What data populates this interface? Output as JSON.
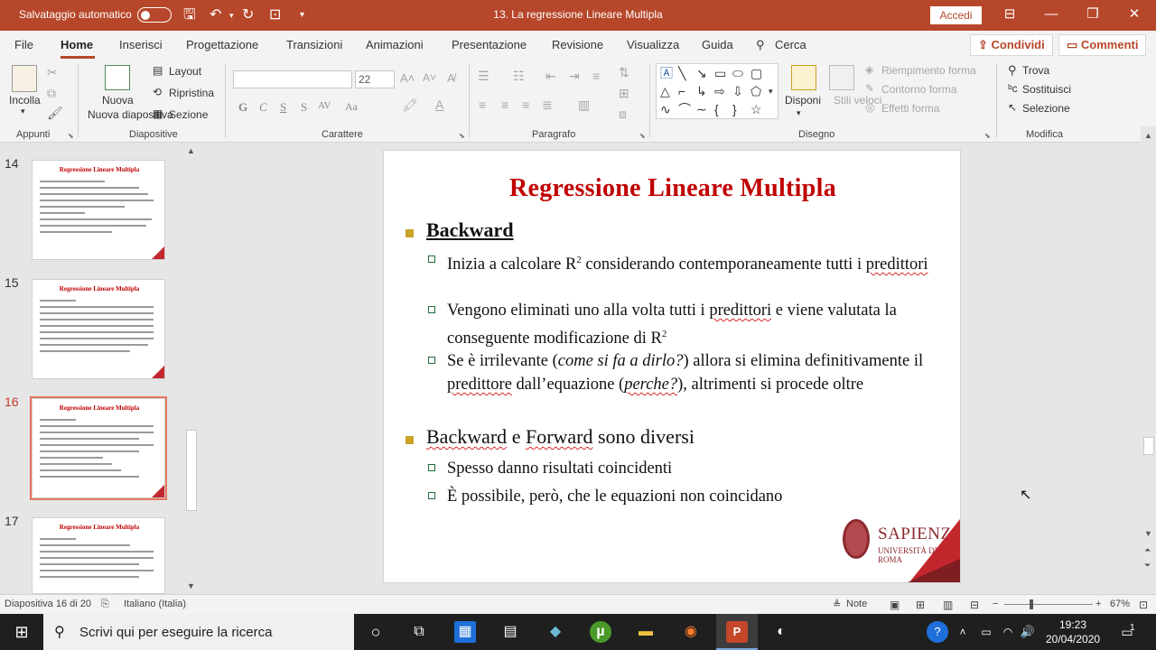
{
  "titlebar": {
    "autosave_label": "Salvataggio automatico",
    "document_title": "13. La regressione Lineare Multipla",
    "signin_label": "Accedi"
  },
  "menu": {
    "tabs": [
      "File",
      "Home",
      "Inserisci",
      "Progettazione",
      "Transizioni",
      "Animazioni",
      "Presentazione",
      "Revisione",
      "Visualizza",
      "Guida",
      "Cerca"
    ],
    "active_tab": "Home",
    "share_label": "Condividi",
    "comments_label": "Commenti"
  },
  "ribbon": {
    "clipboard": {
      "paste_label": "Incolla",
      "group_label": "Appunti"
    },
    "slides": {
      "new_slide_label": "Nuova diapositiva",
      "layout_label": "Layout",
      "reset_label": "Ripristina",
      "section_label": "Sezione",
      "group_label": "Diapositive"
    },
    "font": {
      "font_name_value": "",
      "font_size_value": "22",
      "group_label": "Carattere",
      "format_buttons": [
        "G",
        "C",
        "S",
        "S",
        "AV",
        "Aa"
      ]
    },
    "paragraph": {
      "group_label": "Paragrafo"
    },
    "drawing": {
      "arrange_label": "Disponi",
      "quick_styles_label": "Stili veloci",
      "fill_label": "Riempimento forma",
      "outline_label": "Contorno forma",
      "effects_label": "Effetti forma",
      "group_label": "Disegno"
    },
    "editing": {
      "find_label": "Trova",
      "replace_label": "Sostituisci",
      "select_label": "Selezione",
      "group_label": "Modifica"
    }
  },
  "thumbnails": [
    {
      "number": "14",
      "title": "Regressione Lineare Multipla",
      "selected": false
    },
    {
      "number": "15",
      "title": "Regressione Lineare Multipla",
      "selected": false
    },
    {
      "number": "16",
      "title": "Regressione Lineare Multipla",
      "selected": true
    },
    {
      "number": "17",
      "title": "Regressione Lineare Multipla",
      "selected": false
    }
  ],
  "slide": {
    "title": "Regressione Lineare Multipla",
    "bullets": [
      {
        "text": "Backward"
      },
      {
        "text": "Backward e Forward sono diversi"
      }
    ],
    "sub1": "Inizia a calcolare R² considerando contemporaneamente tutti i predittori",
    "sub2": "Vengono eliminati uno alla volta tutti i predittori e viene valutata la conseguente modificazione di R²",
    "sub3_a": "Se è irrilevante (",
    "sub3_b": "come si fa a dirlo?",
    "sub3_c": ") allora si elimina definitivamente il predittore dall’equazione (",
    "sub3_d": "perche?",
    "sub3_e": "), altrimenti si procede oltre",
    "sub4": "Spesso danno risultati coincidenti",
    "sub5": "È possibile, però, che le equazioni non coincidano",
    "logo_name": "SAPIENZA",
    "logo_sub": "UNIVERSITÀ DI ROMA"
  },
  "statusbar": {
    "slide_counter": "Diapositiva 16 di 20",
    "language": "Italiano (Italia)",
    "notes_label": "Note",
    "zoom": "67%"
  },
  "taskbar": {
    "search_placeholder": "Scrivi qui per eseguire la ricerca",
    "time": "19:23",
    "date": "20/04/2020",
    "notifications": "1"
  },
  "colors": {
    "accent": "#b7472a",
    "slide_title": "#c00000",
    "bullet1": "#c9a227",
    "bullet2": "#1f6d3a",
    "brand": "#8c2a2e"
  }
}
